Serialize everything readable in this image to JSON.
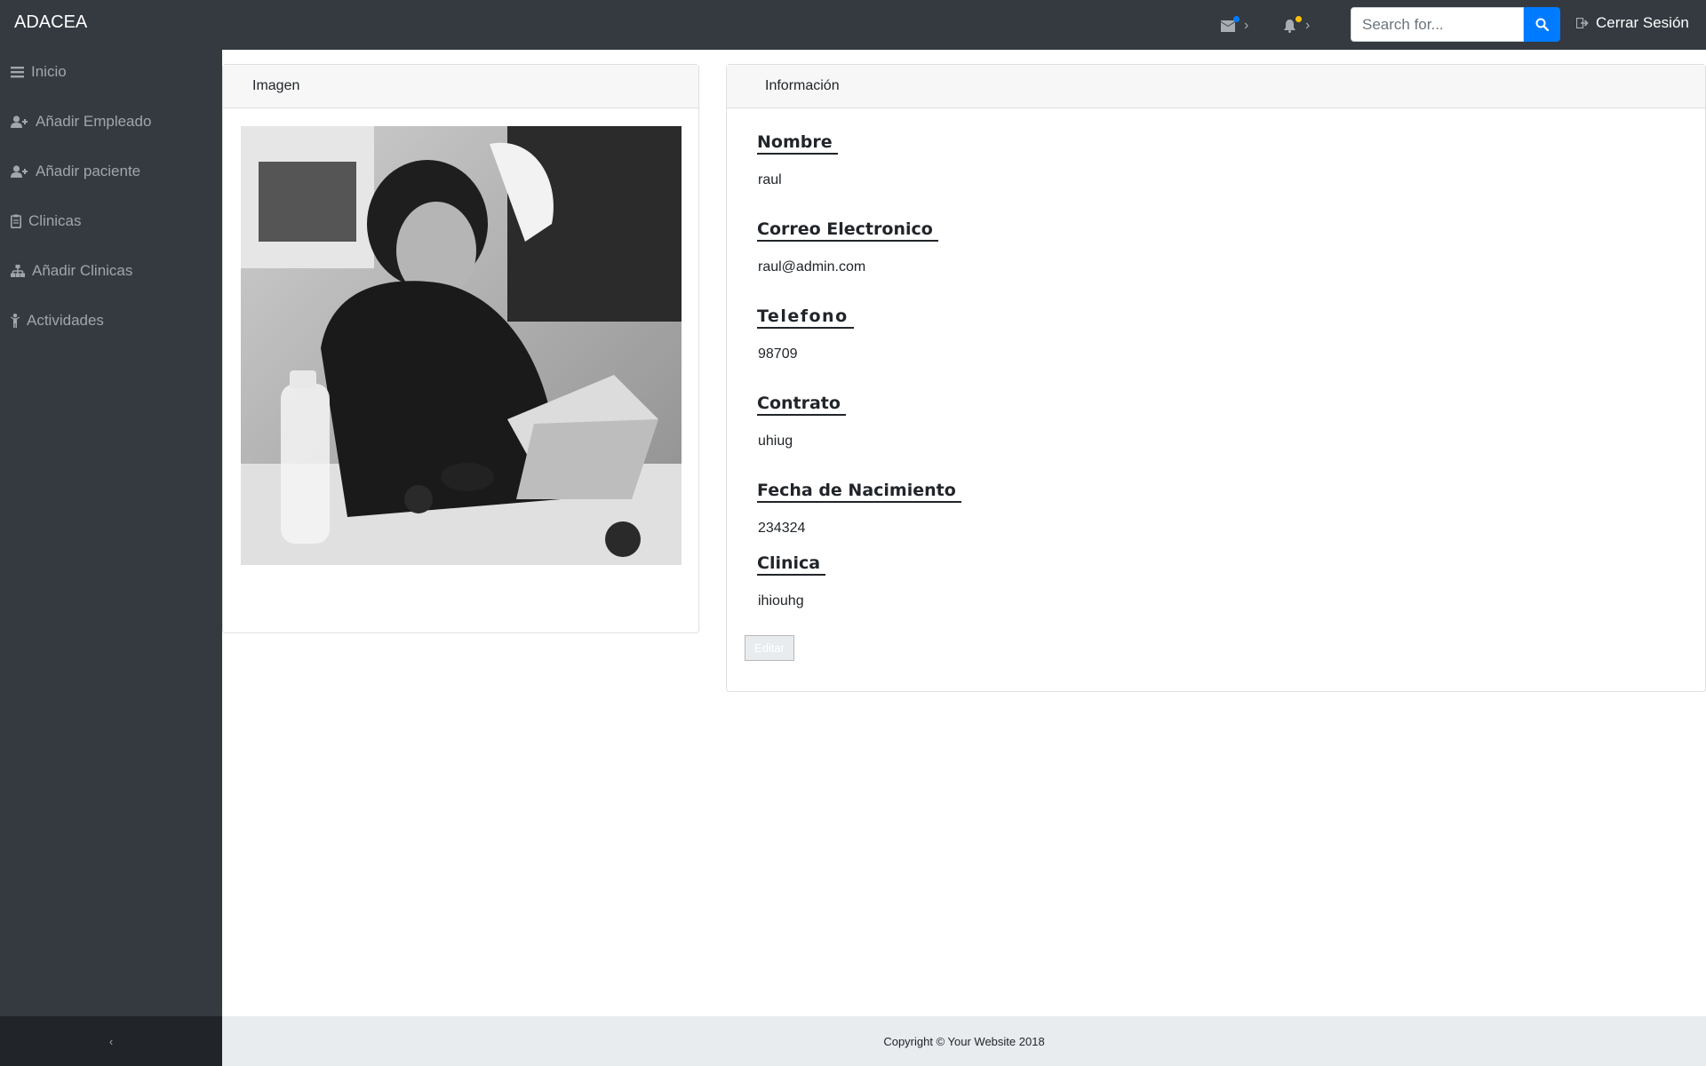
{
  "navbar": {
    "brand": "ADACEA",
    "messages_icon": "envelope-icon",
    "alerts_icon": "bell-icon",
    "search": {
      "placeholder": "Search for...",
      "value": ""
    },
    "logout_label": "Cerrar Sesión"
  },
  "sidebar": {
    "items": [
      {
        "label": "Inicio",
        "icon": "bars-icon"
      },
      {
        "label": "Añadir Empleado",
        "icon": "user-plus-icon"
      },
      {
        "label": "Añadir paciente",
        "icon": "user-plus-icon"
      },
      {
        "label": "Clinicas",
        "icon": "clipboard-icon"
      },
      {
        "label": "Añadir Clinicas",
        "icon": "sitemap-icon"
      },
      {
        "label": "Actividades",
        "icon": "child-icon"
      }
    ],
    "toggle_label": "‹"
  },
  "image_card": {
    "title": "Imagen"
  },
  "info_card": {
    "title": "Información",
    "fields": [
      {
        "label": "Nombre",
        "value": "raul"
      },
      {
        "label": "Correo Electronico",
        "value": "raul@admin.com"
      },
      {
        "label": "Telefono",
        "value": "98709"
      },
      {
        "label": "Contrato",
        "value": "uhiug"
      },
      {
        "label": "Fecha de Nacimiento",
        "value": "234324"
      },
      {
        "label": "Clinica",
        "value": "ihiouhg"
      }
    ],
    "edit_label": "Editar"
  },
  "footer": {
    "copyright": "Copyright © Your Website 2018"
  },
  "colors": {
    "navbar_bg": "#343a40",
    "search_button": "#007bff",
    "messages_badge": "#007bff",
    "alerts_badge": "#ffc107",
    "footer_bg": "#e9ecef"
  }
}
